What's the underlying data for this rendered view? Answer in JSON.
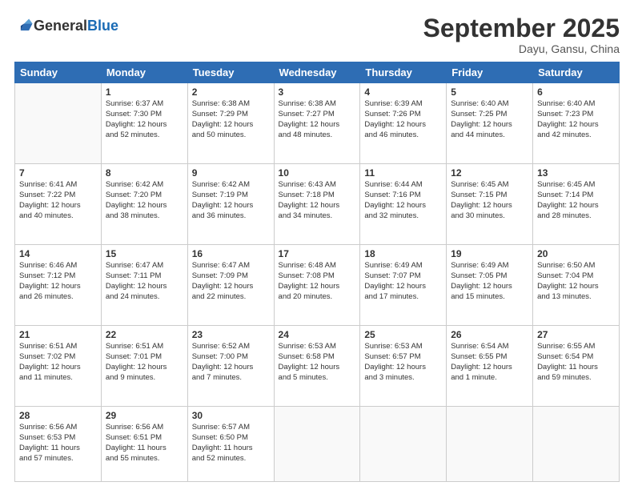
{
  "logo": {
    "general": "General",
    "blue": "Blue"
  },
  "header": {
    "month": "September 2025",
    "location": "Dayu, Gansu, China"
  },
  "weekdays": [
    "Sunday",
    "Monday",
    "Tuesday",
    "Wednesday",
    "Thursday",
    "Friday",
    "Saturday"
  ],
  "weeks": [
    [
      {
        "day": "",
        "info": ""
      },
      {
        "day": "1",
        "info": "Sunrise: 6:37 AM\nSunset: 7:30 PM\nDaylight: 12 hours\nand 52 minutes."
      },
      {
        "day": "2",
        "info": "Sunrise: 6:38 AM\nSunset: 7:29 PM\nDaylight: 12 hours\nand 50 minutes."
      },
      {
        "day": "3",
        "info": "Sunrise: 6:38 AM\nSunset: 7:27 PM\nDaylight: 12 hours\nand 48 minutes."
      },
      {
        "day": "4",
        "info": "Sunrise: 6:39 AM\nSunset: 7:26 PM\nDaylight: 12 hours\nand 46 minutes."
      },
      {
        "day": "5",
        "info": "Sunrise: 6:40 AM\nSunset: 7:25 PM\nDaylight: 12 hours\nand 44 minutes."
      },
      {
        "day": "6",
        "info": "Sunrise: 6:40 AM\nSunset: 7:23 PM\nDaylight: 12 hours\nand 42 minutes."
      }
    ],
    [
      {
        "day": "7",
        "info": "Sunrise: 6:41 AM\nSunset: 7:22 PM\nDaylight: 12 hours\nand 40 minutes."
      },
      {
        "day": "8",
        "info": "Sunrise: 6:42 AM\nSunset: 7:20 PM\nDaylight: 12 hours\nand 38 minutes."
      },
      {
        "day": "9",
        "info": "Sunrise: 6:42 AM\nSunset: 7:19 PM\nDaylight: 12 hours\nand 36 minutes."
      },
      {
        "day": "10",
        "info": "Sunrise: 6:43 AM\nSunset: 7:18 PM\nDaylight: 12 hours\nand 34 minutes."
      },
      {
        "day": "11",
        "info": "Sunrise: 6:44 AM\nSunset: 7:16 PM\nDaylight: 12 hours\nand 32 minutes."
      },
      {
        "day": "12",
        "info": "Sunrise: 6:45 AM\nSunset: 7:15 PM\nDaylight: 12 hours\nand 30 minutes."
      },
      {
        "day": "13",
        "info": "Sunrise: 6:45 AM\nSunset: 7:14 PM\nDaylight: 12 hours\nand 28 minutes."
      }
    ],
    [
      {
        "day": "14",
        "info": "Sunrise: 6:46 AM\nSunset: 7:12 PM\nDaylight: 12 hours\nand 26 minutes."
      },
      {
        "day": "15",
        "info": "Sunrise: 6:47 AM\nSunset: 7:11 PM\nDaylight: 12 hours\nand 24 minutes."
      },
      {
        "day": "16",
        "info": "Sunrise: 6:47 AM\nSunset: 7:09 PM\nDaylight: 12 hours\nand 22 minutes."
      },
      {
        "day": "17",
        "info": "Sunrise: 6:48 AM\nSunset: 7:08 PM\nDaylight: 12 hours\nand 20 minutes."
      },
      {
        "day": "18",
        "info": "Sunrise: 6:49 AM\nSunset: 7:07 PM\nDaylight: 12 hours\nand 17 minutes."
      },
      {
        "day": "19",
        "info": "Sunrise: 6:49 AM\nSunset: 7:05 PM\nDaylight: 12 hours\nand 15 minutes."
      },
      {
        "day": "20",
        "info": "Sunrise: 6:50 AM\nSunset: 7:04 PM\nDaylight: 12 hours\nand 13 minutes."
      }
    ],
    [
      {
        "day": "21",
        "info": "Sunrise: 6:51 AM\nSunset: 7:02 PM\nDaylight: 12 hours\nand 11 minutes."
      },
      {
        "day": "22",
        "info": "Sunrise: 6:51 AM\nSunset: 7:01 PM\nDaylight: 12 hours\nand 9 minutes."
      },
      {
        "day": "23",
        "info": "Sunrise: 6:52 AM\nSunset: 7:00 PM\nDaylight: 12 hours\nand 7 minutes."
      },
      {
        "day": "24",
        "info": "Sunrise: 6:53 AM\nSunset: 6:58 PM\nDaylight: 12 hours\nand 5 minutes."
      },
      {
        "day": "25",
        "info": "Sunrise: 6:53 AM\nSunset: 6:57 PM\nDaylight: 12 hours\nand 3 minutes."
      },
      {
        "day": "26",
        "info": "Sunrise: 6:54 AM\nSunset: 6:55 PM\nDaylight: 12 hours\nand 1 minute."
      },
      {
        "day": "27",
        "info": "Sunrise: 6:55 AM\nSunset: 6:54 PM\nDaylight: 11 hours\nand 59 minutes."
      }
    ],
    [
      {
        "day": "28",
        "info": "Sunrise: 6:56 AM\nSunset: 6:53 PM\nDaylight: 11 hours\nand 57 minutes."
      },
      {
        "day": "29",
        "info": "Sunrise: 6:56 AM\nSunset: 6:51 PM\nDaylight: 11 hours\nand 55 minutes."
      },
      {
        "day": "30",
        "info": "Sunrise: 6:57 AM\nSunset: 6:50 PM\nDaylight: 11 hours\nand 52 minutes."
      },
      {
        "day": "",
        "info": ""
      },
      {
        "day": "",
        "info": ""
      },
      {
        "day": "",
        "info": ""
      },
      {
        "day": "",
        "info": ""
      }
    ]
  ]
}
